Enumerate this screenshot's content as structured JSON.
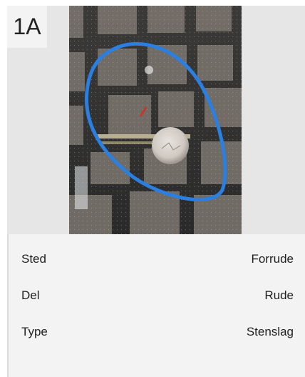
{
  "badge": {
    "text": "1A"
  },
  "photo": {
    "subject": "windshield-stone-chip"
  },
  "details": {
    "rows": [
      {
        "label": "Sted",
        "value": "Forrude"
      },
      {
        "label": "Del",
        "value": "Rude"
      },
      {
        "label": "Type",
        "value": "Stenslag"
      }
    ]
  },
  "colors": {
    "card_bg": "#f3f3f3",
    "photo_area_bg": "#e6e6e6",
    "marker_blue": "#2a7fe0"
  }
}
